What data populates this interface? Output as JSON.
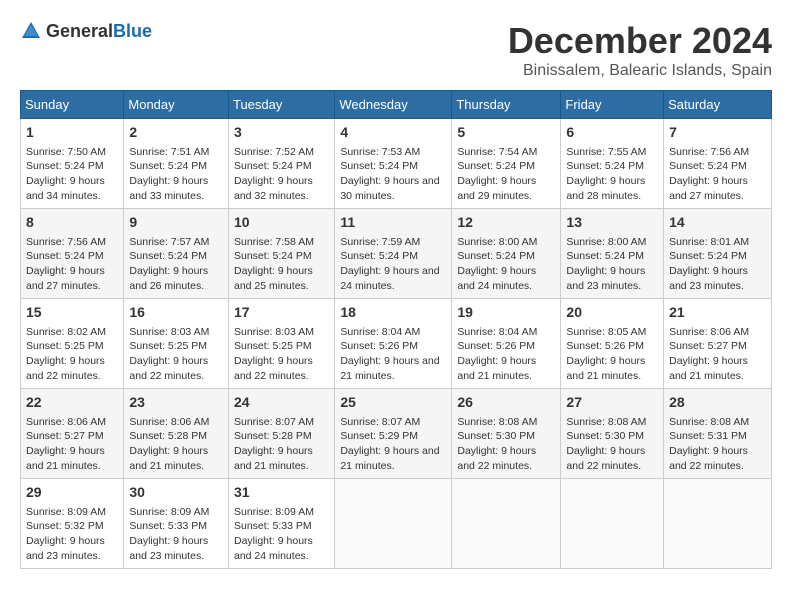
{
  "logo": {
    "general": "General",
    "blue": "Blue"
  },
  "title": {
    "month": "December 2024",
    "location": "Binissalem, Balearic Islands, Spain"
  },
  "weekdays": [
    "Sunday",
    "Monday",
    "Tuesday",
    "Wednesday",
    "Thursday",
    "Friday",
    "Saturday"
  ],
  "weeks": [
    [
      {
        "day": "1",
        "sunrise": "7:50 AM",
        "sunset": "5:24 PM",
        "daylight": "9 hours and 34 minutes."
      },
      {
        "day": "2",
        "sunrise": "7:51 AM",
        "sunset": "5:24 PM",
        "daylight": "9 hours and 33 minutes."
      },
      {
        "day": "3",
        "sunrise": "7:52 AM",
        "sunset": "5:24 PM",
        "daylight": "9 hours and 32 minutes."
      },
      {
        "day": "4",
        "sunrise": "7:53 AM",
        "sunset": "5:24 PM",
        "daylight": "9 hours and 30 minutes."
      },
      {
        "day": "5",
        "sunrise": "7:54 AM",
        "sunset": "5:24 PM",
        "daylight": "9 hours and 29 minutes."
      },
      {
        "day": "6",
        "sunrise": "7:55 AM",
        "sunset": "5:24 PM",
        "daylight": "9 hours and 28 minutes."
      },
      {
        "day": "7",
        "sunrise": "7:56 AM",
        "sunset": "5:24 PM",
        "daylight": "9 hours and 27 minutes."
      }
    ],
    [
      {
        "day": "8",
        "sunrise": "7:56 AM",
        "sunset": "5:24 PM",
        "daylight": "9 hours and 27 minutes."
      },
      {
        "day": "9",
        "sunrise": "7:57 AM",
        "sunset": "5:24 PM",
        "daylight": "9 hours and 26 minutes."
      },
      {
        "day": "10",
        "sunrise": "7:58 AM",
        "sunset": "5:24 PM",
        "daylight": "9 hours and 25 minutes."
      },
      {
        "day": "11",
        "sunrise": "7:59 AM",
        "sunset": "5:24 PM",
        "daylight": "9 hours and 24 minutes."
      },
      {
        "day": "12",
        "sunrise": "8:00 AM",
        "sunset": "5:24 PM",
        "daylight": "9 hours and 24 minutes."
      },
      {
        "day": "13",
        "sunrise": "8:00 AM",
        "sunset": "5:24 PM",
        "daylight": "9 hours and 23 minutes."
      },
      {
        "day": "14",
        "sunrise": "8:01 AM",
        "sunset": "5:24 PM",
        "daylight": "9 hours and 23 minutes."
      }
    ],
    [
      {
        "day": "15",
        "sunrise": "8:02 AM",
        "sunset": "5:25 PM",
        "daylight": "9 hours and 22 minutes."
      },
      {
        "day": "16",
        "sunrise": "8:03 AM",
        "sunset": "5:25 PM",
        "daylight": "9 hours and 22 minutes."
      },
      {
        "day": "17",
        "sunrise": "8:03 AM",
        "sunset": "5:25 PM",
        "daylight": "9 hours and 22 minutes."
      },
      {
        "day": "18",
        "sunrise": "8:04 AM",
        "sunset": "5:26 PM",
        "daylight": "9 hours and 21 minutes."
      },
      {
        "day": "19",
        "sunrise": "8:04 AM",
        "sunset": "5:26 PM",
        "daylight": "9 hours and 21 minutes."
      },
      {
        "day": "20",
        "sunrise": "8:05 AM",
        "sunset": "5:26 PM",
        "daylight": "9 hours and 21 minutes."
      },
      {
        "day": "21",
        "sunrise": "8:06 AM",
        "sunset": "5:27 PM",
        "daylight": "9 hours and 21 minutes."
      }
    ],
    [
      {
        "day": "22",
        "sunrise": "8:06 AM",
        "sunset": "5:27 PM",
        "daylight": "9 hours and 21 minutes."
      },
      {
        "day": "23",
        "sunrise": "8:06 AM",
        "sunset": "5:28 PM",
        "daylight": "9 hours and 21 minutes."
      },
      {
        "day": "24",
        "sunrise": "8:07 AM",
        "sunset": "5:28 PM",
        "daylight": "9 hours and 21 minutes."
      },
      {
        "day": "25",
        "sunrise": "8:07 AM",
        "sunset": "5:29 PM",
        "daylight": "9 hours and 21 minutes."
      },
      {
        "day": "26",
        "sunrise": "8:08 AM",
        "sunset": "5:30 PM",
        "daylight": "9 hours and 22 minutes."
      },
      {
        "day": "27",
        "sunrise": "8:08 AM",
        "sunset": "5:30 PM",
        "daylight": "9 hours and 22 minutes."
      },
      {
        "day": "28",
        "sunrise": "8:08 AM",
        "sunset": "5:31 PM",
        "daylight": "9 hours and 22 minutes."
      }
    ],
    [
      {
        "day": "29",
        "sunrise": "8:09 AM",
        "sunset": "5:32 PM",
        "daylight": "9 hours and 23 minutes."
      },
      {
        "day": "30",
        "sunrise": "8:09 AM",
        "sunset": "5:33 PM",
        "daylight": "9 hours and 23 minutes."
      },
      {
        "day": "31",
        "sunrise": "8:09 AM",
        "sunset": "5:33 PM",
        "daylight": "9 hours and 24 minutes."
      },
      null,
      null,
      null,
      null
    ]
  ],
  "labels": {
    "sunrise": "Sunrise:",
    "sunset": "Sunset:",
    "daylight": "Daylight:"
  }
}
